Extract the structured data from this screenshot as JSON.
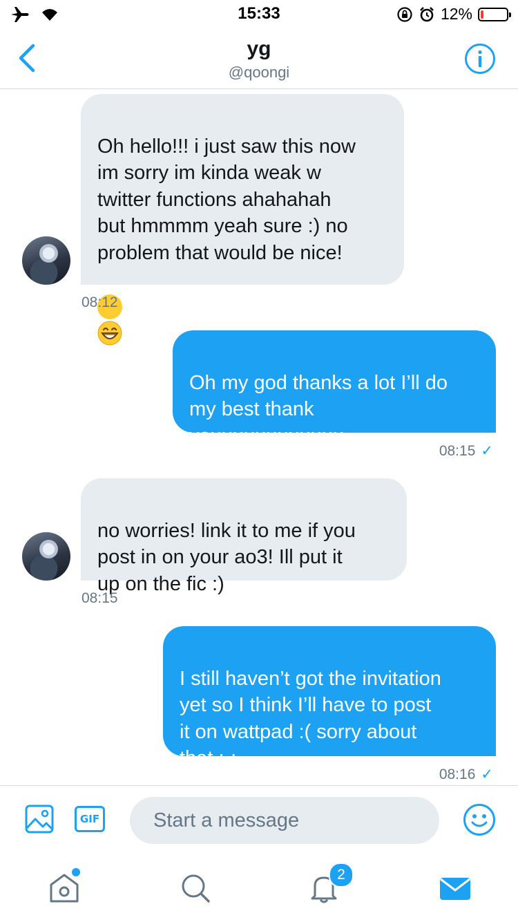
{
  "status_bar": {
    "time": "15:33",
    "battery": "12%",
    "battery_level": 0.12
  },
  "header": {
    "name": "yg",
    "handle": "@qoongi"
  },
  "messages": [
    {
      "direction": "received",
      "text": "Oh hello!!! i just saw this now\nim sorry im kinda weak w\ntwitter functions ahahahah\nbut hmmmm yeah sure :) no\nproblem that would be nice!",
      "emoji": "grinning-face",
      "time": "08:12"
    },
    {
      "direction": "sent",
      "text": "Oh my god thanks a lot I’ll do\nmy best thank\nyouuuuuuuuuuuu",
      "time": "08:15",
      "read_mark": "✓"
    },
    {
      "direction": "received",
      "text": "no worries! link it to me if you\npost in on your ao3! Ill put it\nup on the fic :)",
      "time": "08:15"
    },
    {
      "direction": "sent",
      "text": "I still haven’t got the invitation\nyet so I think I’ll have to post\nit on wattpad :( sorry about\nthat ;-;",
      "time": "08:16",
      "read_mark": "✓"
    }
  ],
  "composer": {
    "placeholder": "Start a message",
    "gif_label": "GIF"
  },
  "tabbar": {
    "notifications_badge": "2"
  },
  "colors": {
    "accent": "#1da1f2",
    "received_bubble": "#e6ecf0",
    "muted_text": "#657786"
  }
}
